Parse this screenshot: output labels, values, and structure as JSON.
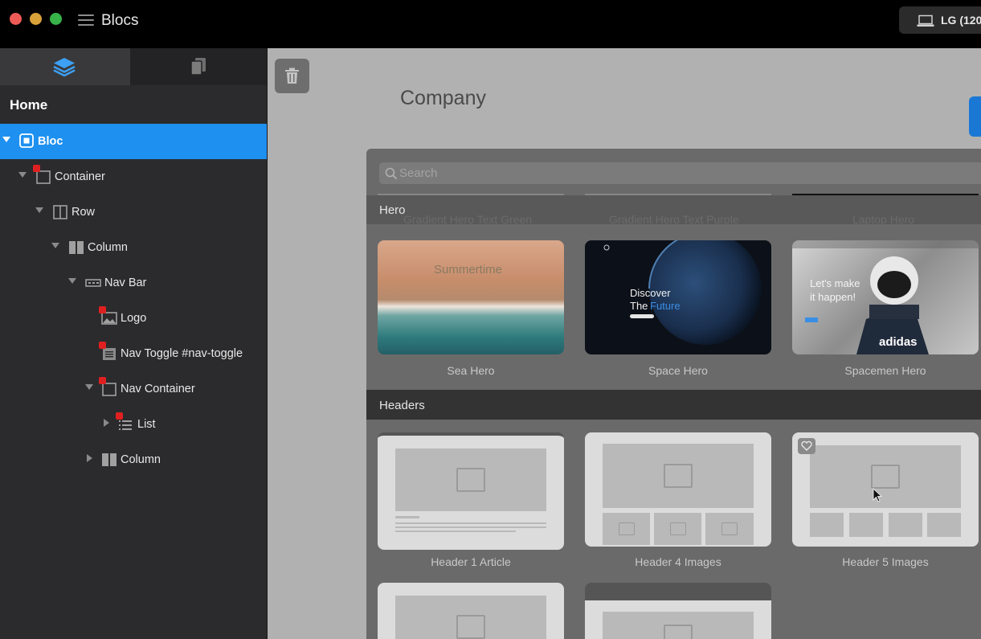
{
  "window": {
    "title": "Blocs",
    "device_button": "LG (120"
  },
  "sidebar": {
    "page_name": "Home",
    "tree": [
      {
        "label": "Bloc"
      },
      {
        "label": "Container"
      },
      {
        "label": "Row"
      },
      {
        "label": "Column"
      },
      {
        "label": "Nav Bar"
      },
      {
        "label": "Logo"
      },
      {
        "label": "Nav Toggle #nav-toggle"
      },
      {
        "label": "Nav Container"
      },
      {
        "label": "List"
      },
      {
        "label": "Column"
      }
    ]
  },
  "canvas": {
    "page_heading": "Company"
  },
  "library": {
    "search_placeholder": "Search",
    "hero_section": "Hero",
    "ghost_labels": [
      "Gradient Hero Text Green",
      "Gradient Hero Text Purple",
      "Laptop Hero"
    ],
    "hero_items": [
      "Sea Hero",
      "Space Hero",
      "Spacemen Hero"
    ],
    "sea_text": "Summertime",
    "space_text_line1": "Discover",
    "space_text_line2": "The",
    "space_text_accent": "Future",
    "spacemen_text_line1": "Let's make",
    "spacemen_text_line2": "it happen!",
    "spacemen_shirt": "adidas",
    "headers_section": "Headers",
    "header_items": [
      "Header 1 Article",
      "Header 4 Images",
      "Header 5 Images"
    ]
  },
  "colors": {
    "selection": "#1e90f0",
    "lock_badge": "#e02020",
    "accent_future": "#3a8ee6"
  }
}
